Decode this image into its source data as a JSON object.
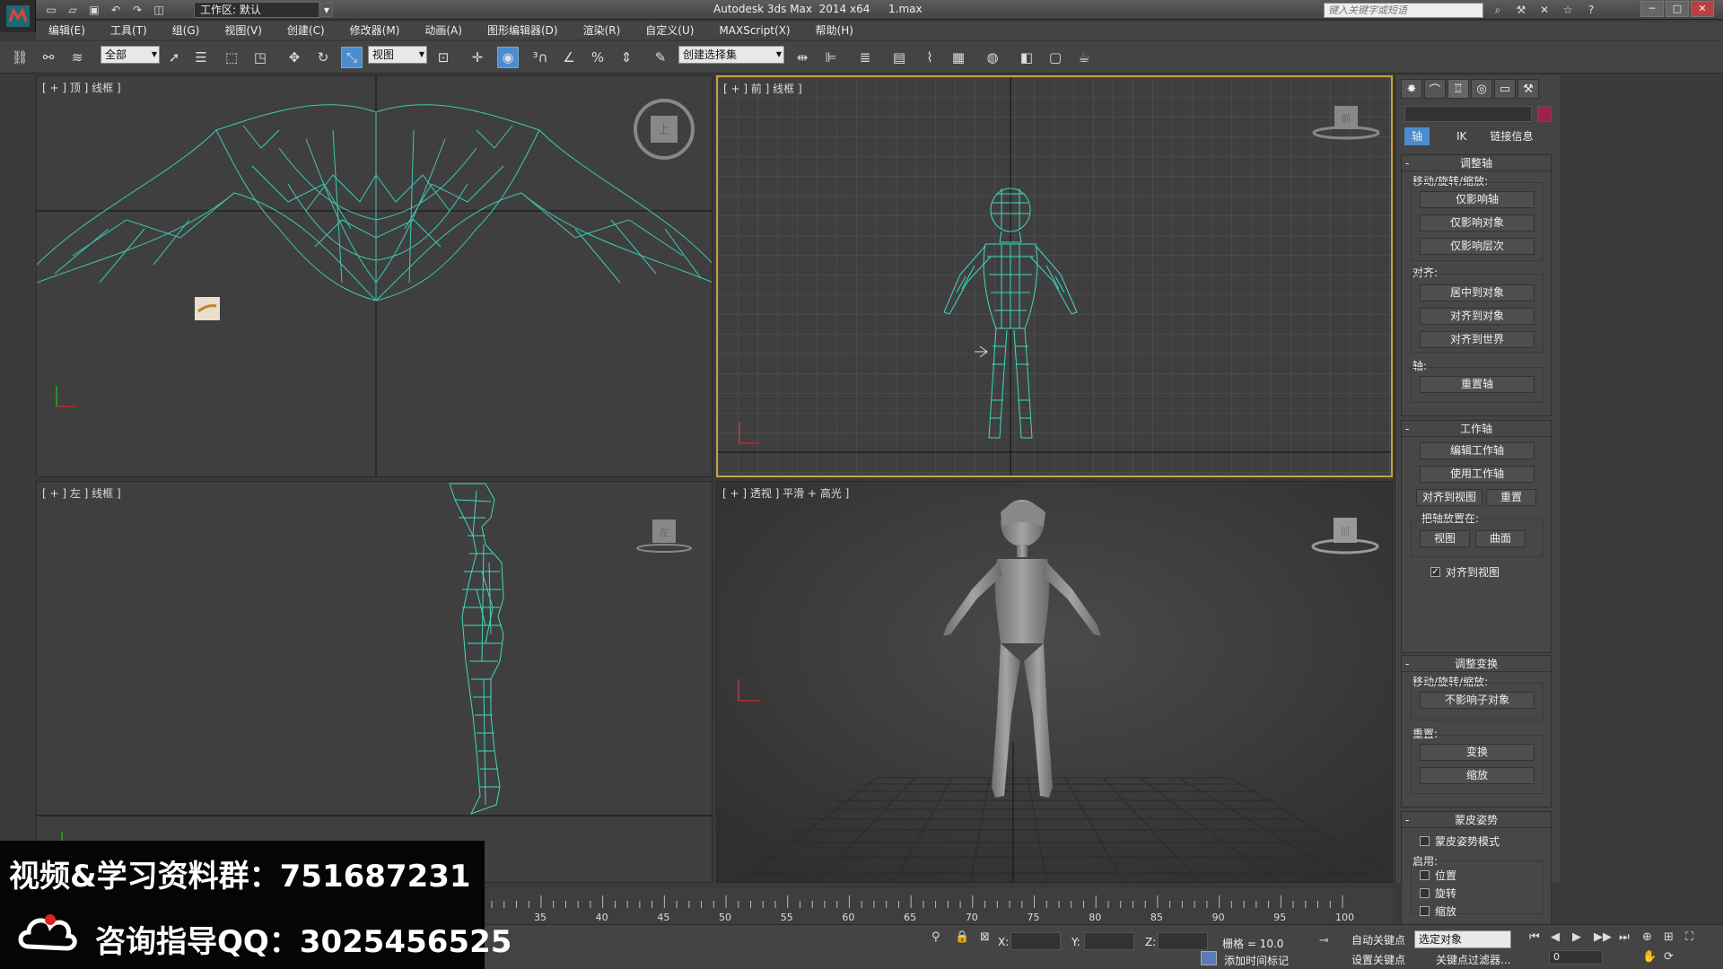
{
  "titlebar": {
    "workspace": "工作区: 默认",
    "app_title": "Autodesk 3ds Max  2014 x64",
    "file_name": "1.max",
    "search_placeholder": "键入关键字或短语"
  },
  "menu": [
    "编辑(E)",
    "工具(T)",
    "组(G)",
    "视图(V)",
    "创建(C)",
    "修改器(M)",
    "动画(A)",
    "图形编辑器(D)",
    "渲染(R)",
    "自定义(U)",
    "MAXScript(X)",
    "帮助(H)"
  ],
  "toolbar": {
    "filter_select": "全部",
    "ref_coord_select": "视图",
    "named_selection": "创建选择集"
  },
  "viewports": {
    "top": {
      "label": "[ + ] 顶 ] 线框 ]",
      "cube_label": "上"
    },
    "front": {
      "label": "[ + ] 前 ] 线框 ]",
      "cube_label": "前"
    },
    "left": {
      "label": "[ + ] 左 ] 线框 ]",
      "cube_label": "左"
    },
    "perspective": {
      "label": "[ + ] 透视 ] 平滑 + 高光 ]",
      "cube_label": "前"
    }
  },
  "command_panel": {
    "subtabs": [
      "轴",
      "IK",
      "链接信息"
    ],
    "adjust_pivot": {
      "title": "调整轴",
      "move_label": "移动/旋转/缩放:",
      "buttons": [
        "仅影响轴",
        "仅影响对象",
        "仅影响层次"
      ],
      "align_label": "对齐:",
      "align_buttons": [
        "居中到对象",
        "对齐到对象",
        "对齐到世界"
      ],
      "pivot_label": "轴:",
      "reset_button": "重置轴"
    },
    "working_pivot": {
      "title": "工作轴",
      "edit_button": "编辑工作轴",
      "use_button": "使用工作轴",
      "align_view_button": "对齐到视图",
      "reset_button": "重置",
      "place_label": "把轴放置在:",
      "view_button": "视图",
      "surface_button": "曲面",
      "align_to_view_check": "对齐到视图"
    },
    "adjust_transform": {
      "title": "调整变换",
      "move_label": "移动/旋转/缩放:",
      "children_button": "不影响子对象",
      "reset_label": "重置:",
      "transform_button": "变换",
      "scale_button": "缩放"
    },
    "skin_pose": {
      "title": "蒙皮姿势",
      "mode_check": "蒙皮姿势模式",
      "enable_label": "启用:",
      "checks": [
        "位置",
        "旋转",
        "缩放"
      ]
    }
  },
  "timeline": {
    "ticks": [
      "35",
      "40",
      "45",
      "50",
      "55",
      "60",
      "65",
      "70",
      "75",
      "80",
      "85",
      "90",
      "95",
      "100"
    ]
  },
  "statusbar": {
    "x_label": "X:",
    "y_label": "Y:",
    "z_label": "Z:",
    "grid": "栅格 = 10.0",
    "auto_key": "自动关键点",
    "set_key": "设置关键点",
    "key_select": "选定对象",
    "add_time_tag": "添加时间标记",
    "key_filters": "关键点过滤器...",
    "frame": "0"
  },
  "overlay": {
    "line1": "视频&学习资料群：751687231",
    "line2": "咨询指导QQ：3025456525"
  },
  "colors": {
    "wire": "#3fd8c0",
    "accent": "#4a8ccf",
    "active_border": "#c8a040"
  }
}
